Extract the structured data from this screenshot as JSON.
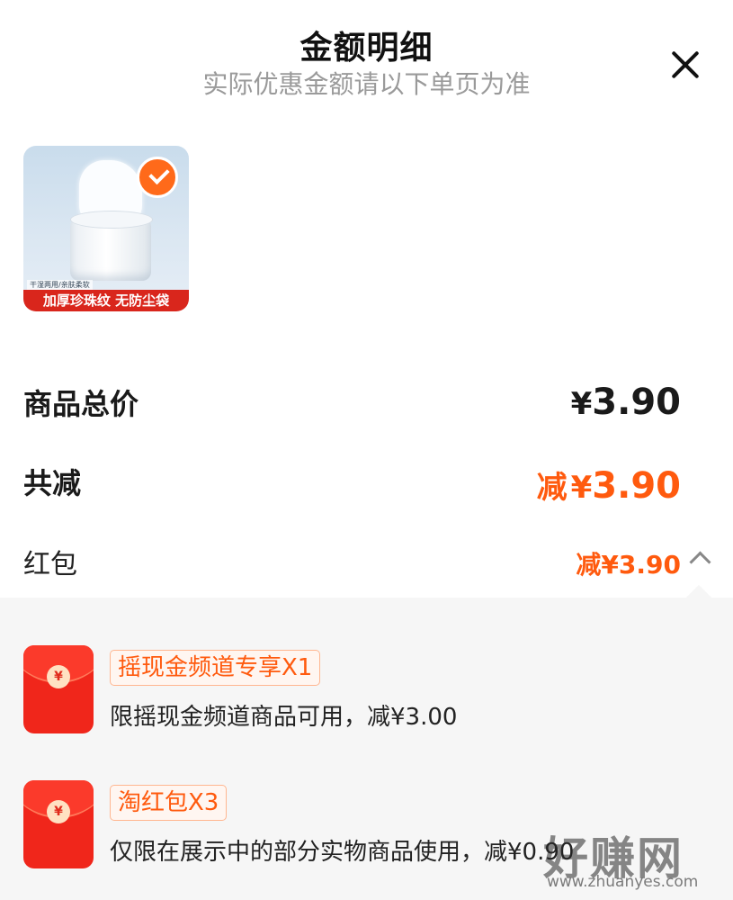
{
  "header": {
    "title": "金额明细",
    "subtitle": "实际优惠金额请以下单页为准",
    "close_icon": "close-icon"
  },
  "product": {
    "thumb_small_text": "干湿两用/亲肤柔软",
    "thumb_banner": "加厚珍珠纹 无防尘袋",
    "selected": true
  },
  "summary": {
    "total_label": "商品总价",
    "total_currency": "¥",
    "total_amount": "3.90",
    "discount_label": "共减",
    "discount_prefix": "减",
    "discount_currency": "¥",
    "discount_amount": "3.90"
  },
  "hongbao": {
    "label": "红包",
    "value": "减¥3.90",
    "expanded": true,
    "items": [
      {
        "tag": "摇现金频道专享X1",
        "desc": "限摇现金频道商品可用，减¥3.00",
        "coin": "¥"
      },
      {
        "tag": "淘红包X3",
        "desc": "仅限在展示中的部分实物商品使用，减¥0.90",
        "coin": "¥"
      }
    ]
  },
  "watermark": {
    "main": "好赚网",
    "sub": "www.zhuanyes.com"
  },
  "colors": {
    "accent": "#ff5a0e",
    "badge": "#ff6a1a",
    "coupon_red": "#f0261b"
  }
}
